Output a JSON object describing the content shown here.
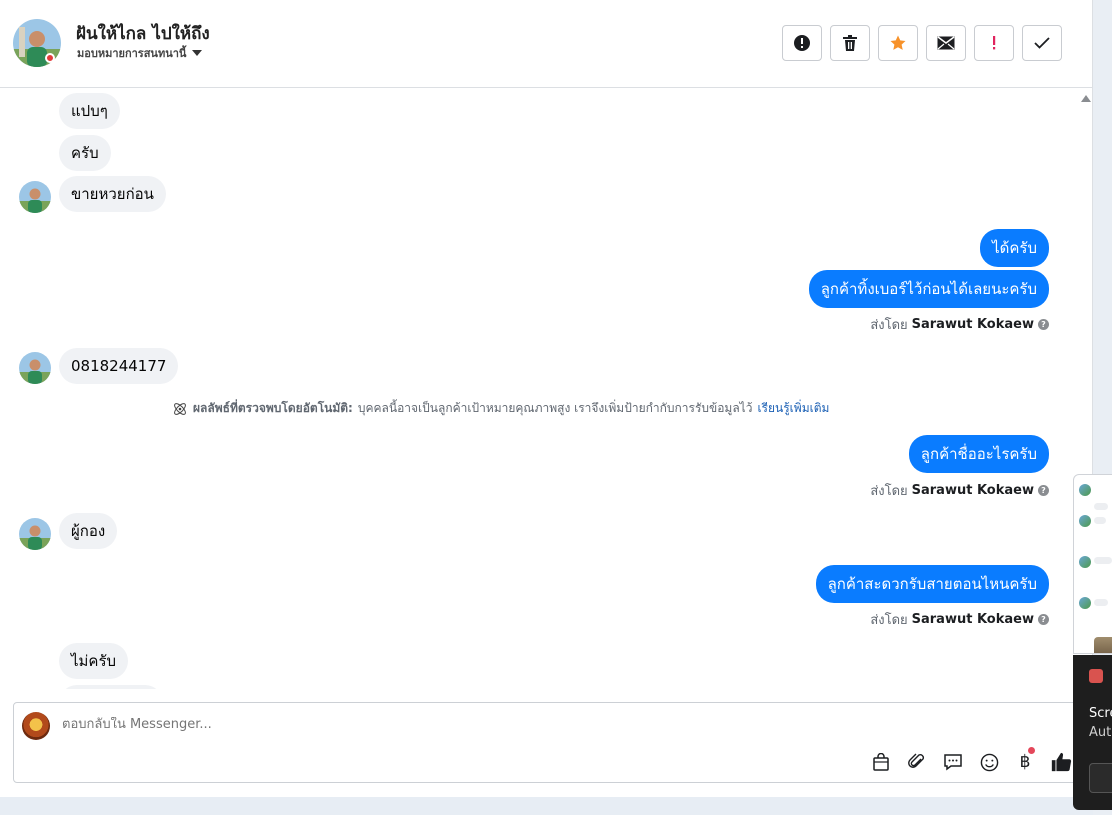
{
  "header": {
    "contact_name": "ฝันให้ไกล ไปให้ถึง",
    "assigned_label": "มอบหมายการสนทนานี้",
    "buttons": [
      {
        "name": "spam-report",
        "icon": "exclamation-circle-icon"
      },
      {
        "name": "delete",
        "icon": "trash-icon"
      },
      {
        "name": "star",
        "icon": "star-icon",
        "color": "#f7922a"
      },
      {
        "name": "mark-unread",
        "icon": "envelope-icon"
      },
      {
        "name": "follow-up",
        "icon": "exclamation-icon",
        "color": "#e0245e"
      },
      {
        "name": "mark-done",
        "icon": "checkmark-icon"
      }
    ]
  },
  "messages": {
    "m1": "แปบๆ",
    "m2": "ครับ",
    "m3": "ขายหวยก่อน",
    "m4": "ได้ครับ",
    "m5": "ลูกค้าทิ้งเบอร์ไว้ก่อนได้เลยนะครับ",
    "sent_prefix": "ส่งโดย",
    "sender": "Sarawut Kokaew",
    "m6": "0818244177",
    "ai_bold": "ผลลัพธ์ที่ตรวจพบโดยอัตโนมัติ:",
    "ai_text": "บุคคลนี้อาจเป็นลูกค้าเป้าหมายคุณภาพสูง เราจึงเพิ่มป้ายกำกับการรับข้อมูลไว้",
    "ai_link": "เรียนรู้เพิ่มเติม",
    "m7": "ลูกค้าชื่ออะไรครับ",
    "m8": "ผู้กอง",
    "m9": "ลูกค้าสะดวกรับสายตอนไหนครับ",
    "m10": "ไม่ครับ"
  },
  "composer": {
    "placeholder": "ตอบกลับใน Messenger...",
    "tools": [
      "bag-icon",
      "paperclip-icon",
      "saved-reply-icon",
      "emoji-icon",
      "baht-icon",
      "thumbs-up-icon"
    ]
  },
  "toast": {
    "title": "Scre",
    "subtitle": "Aut"
  },
  "colors": {
    "outgoing_bubble": "#0a7cff",
    "incoming_bubble": "#f0f2f5"
  }
}
